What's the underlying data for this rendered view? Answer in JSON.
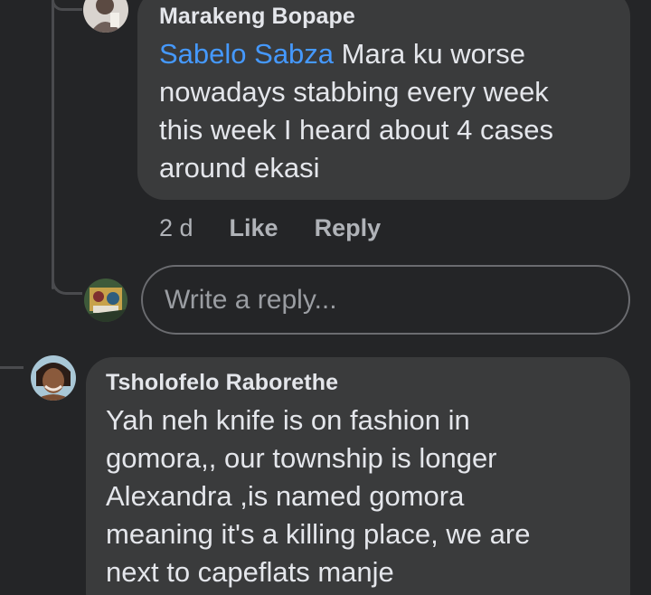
{
  "comments": [
    {
      "author": "Marakeng Bopape",
      "mention": "Sabelo Sabza",
      "text_lines": [
        "Mara ku worse",
        "nowadays stabbing every week",
        "this week I heard about 4 cases",
        "around ekasi"
      ],
      "time": "2 d",
      "like_label": "Like",
      "reply_label": "Reply"
    },
    {
      "author": "Tsholofelo Raborethe",
      "text_lines": [
        "Yah neh knife is on fashion in",
        "gomora,, our township is longer",
        "Alexandra ,is named gomora",
        "meaning it's a killing place, we are",
        "next to capeflats manje"
      ]
    }
  ],
  "reply_box": {
    "placeholder": "Write a reply..."
  },
  "colors": {
    "background": "#242527",
    "bubble": "#3a3b3c",
    "text": "#e4e6eb",
    "secondary_text": "#b0b3b8",
    "mention": "#4599ff",
    "thread_line": "#4a4b4e"
  },
  "icons": [
    "commenter-avatar-photo",
    "current-user-avatar-photo",
    "second-commenter-avatar-photo"
  ]
}
